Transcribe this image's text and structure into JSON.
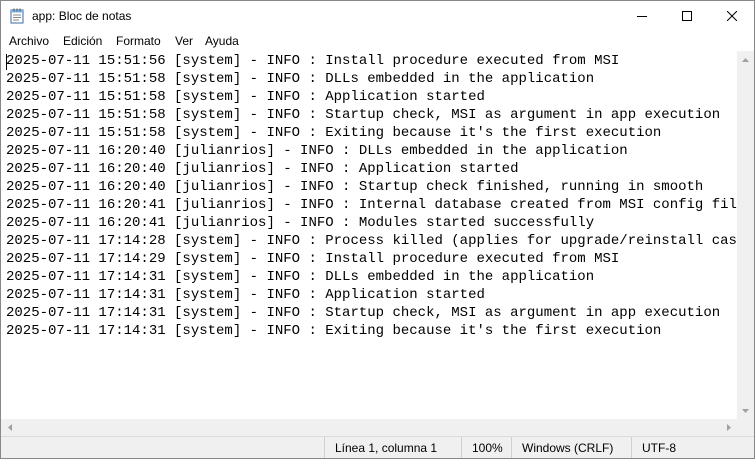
{
  "window": {
    "title": "app: Bloc de notas",
    "icon": "notepad-icon",
    "controls": [
      "minimize-icon",
      "maximize-icon",
      "close-icon"
    ]
  },
  "menu": {
    "file": "Archivo",
    "edit": "Edición",
    "format": "Formato",
    "view": "Ver",
    "help": "Ayuda"
  },
  "editor": {
    "lines": [
      "2025-07-11 15:51:56 [system] - INFO : Install procedure executed from MSI",
      "2025-07-11 15:51:58 [system] - INFO : DLLs embedded in the application",
      "2025-07-11 15:51:58 [system] - INFO : Application started",
      "2025-07-11 15:51:58 [system] - INFO : Startup check, MSI as argument in app execution",
      "2025-07-11 15:51:58 [system] - INFO : Exiting because it's the first execution",
      "2025-07-11 16:20:40 [julianrios] - INFO : DLLs embedded in the application",
      "2025-07-11 16:20:40 [julianrios] - INFO : Application started",
      "2025-07-11 16:20:40 [julianrios] - INFO : Startup check finished, running in smooth",
      "2025-07-11 16:20:41 [julianrios] - INFO : Internal database created from MSI config file",
      "2025-07-11 16:20:41 [julianrios] - INFO : Modules started successfully",
      "2025-07-11 17:14:28 [system] - INFO : Process killed (applies for upgrade/reinstall case)",
      "2025-07-11 17:14:29 [system] - INFO : Install procedure executed from MSI",
      "2025-07-11 17:14:31 [system] - INFO : DLLs embedded in the application",
      "2025-07-11 17:14:31 [system] - INFO : Application started",
      "2025-07-11 17:14:31 [system] - INFO : Startup check, MSI as argument in app execution",
      "2025-07-11 17:14:31 [system] - INFO : Exiting because it's the first execution"
    ]
  },
  "status": {
    "position": "Línea 1, columna 1",
    "zoom": "100%",
    "line_ending": "Windows (CRLF)",
    "encoding": "UTF-8"
  },
  "colors": {
    "background": "#ffffff",
    "chrome": "#f0f0f0",
    "text": "#000000"
  }
}
